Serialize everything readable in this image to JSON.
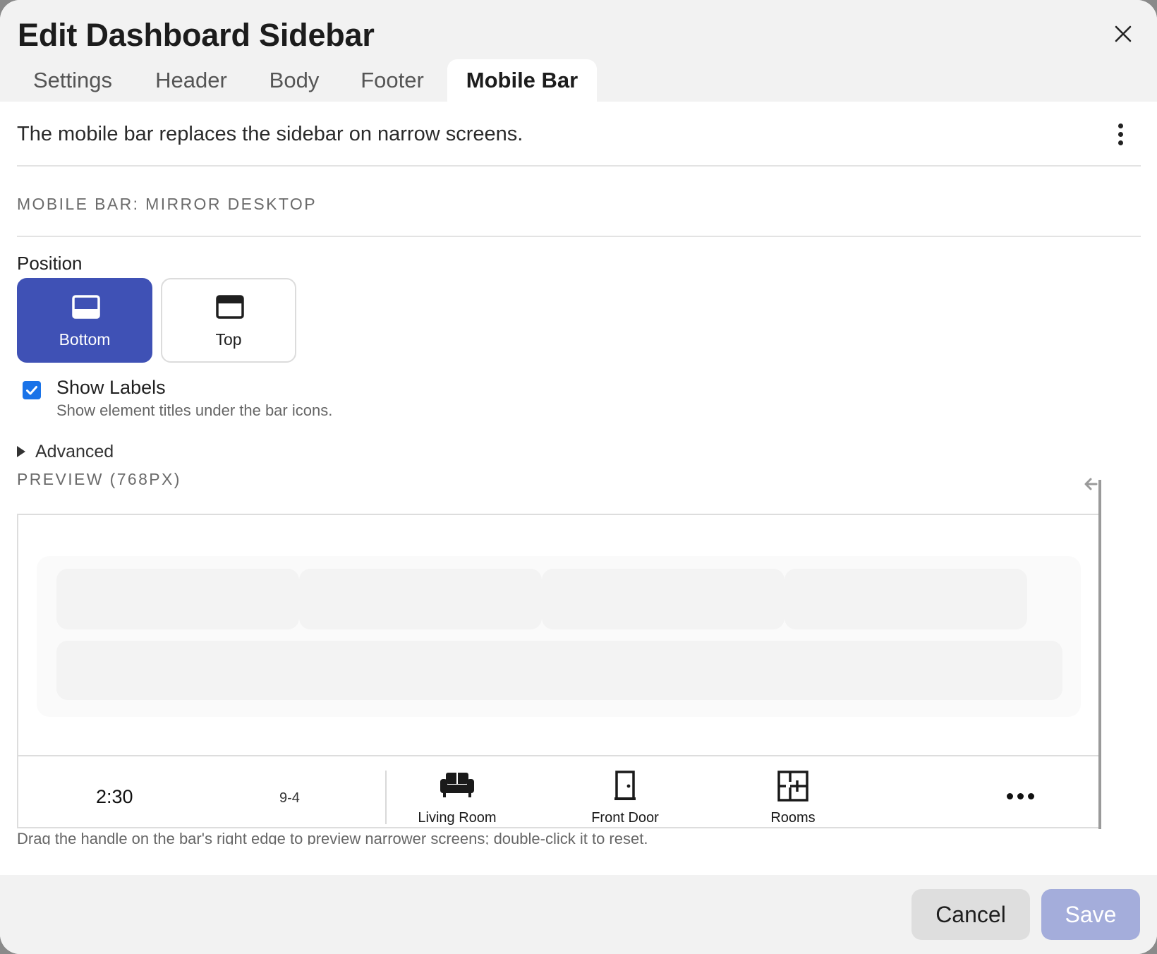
{
  "dialog": {
    "title": "Edit Dashboard Sidebar",
    "tabs": [
      {
        "label": "Settings",
        "active": false
      },
      {
        "label": "Header",
        "active": false
      },
      {
        "label": "Body",
        "active": false
      },
      {
        "label": "Footer",
        "active": false
      },
      {
        "label": "Mobile Bar",
        "active": true
      }
    ]
  },
  "content": {
    "intro": "The mobile bar replaces the sidebar on narrow screens.",
    "mode_label": "MOBILE BAR: MIRROR DESKTOP",
    "position": {
      "label": "Position",
      "options": [
        {
          "label": "Bottom",
          "icon": "bar-bottom-icon",
          "selected": true
        },
        {
          "label": "Top",
          "icon": "bar-top-icon",
          "selected": false
        }
      ]
    },
    "show_labels": {
      "checked": true,
      "title": "Show Labels",
      "help": "Show element titles under the bar icons."
    },
    "advanced": {
      "label": "Advanced",
      "expanded": false
    },
    "preview": {
      "label": "PREVIEW (768PX)",
      "bar": {
        "clock": "2:30",
        "date": "9-4",
        "items": [
          {
            "label": "Living Room",
            "icon": "sofa-icon"
          },
          {
            "label": "Front Door",
            "icon": "door-icon"
          },
          {
            "label": "Rooms",
            "icon": "floorplan-icon"
          }
        ],
        "more_icon": "more-horizontal-icon"
      },
      "hint": "Drag the handle on the bar's right edge to preview narrower screens; double-click it to reset."
    }
  },
  "footer": {
    "cancel_label": "Cancel",
    "save_label": "Save"
  },
  "colors": {
    "accent": "#3f51b5",
    "checkbox": "#1a73e8",
    "save_disabled": "#a4addb",
    "header_bg": "#f2f2f2"
  }
}
